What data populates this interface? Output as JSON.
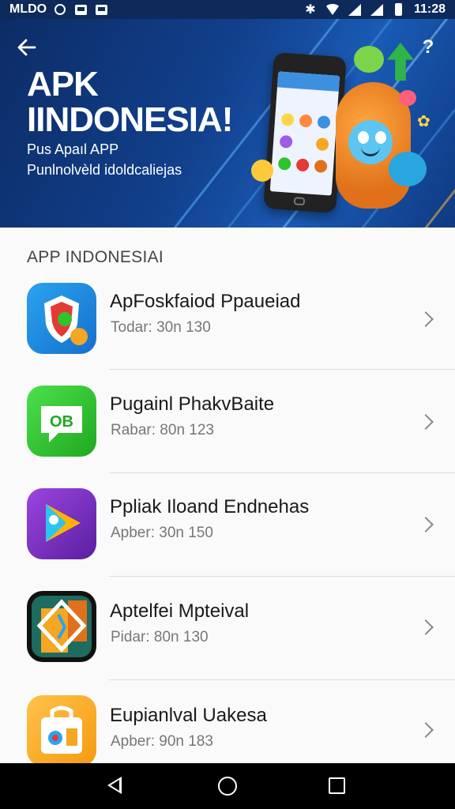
{
  "status_bar": {
    "carrier": "MLDO",
    "time": "11:28",
    "icons": [
      "sync-icon",
      "gallery-icon",
      "image-icon",
      "bluetooth-icon",
      "wifi-icon",
      "signal-icon",
      "signal-icon",
      "battery-icon"
    ]
  },
  "banner": {
    "title_line1": "APK",
    "title_line2": "IINDONESIA!",
    "subtitle_line1": "Pus Apaıl APP",
    "subtitle_line2": "Punlnolvèld idoldcaliejas",
    "back_icon": "arrow-left-icon",
    "help_icon": "question-icon",
    "colors": {
      "bg_start": "#0c2c66",
      "bg_end": "#1a5bb5",
      "accent": "#ff9f2e"
    }
  },
  "section": {
    "title": "APP INDONESIAI"
  },
  "apps": [
    {
      "name": "ApFoskfaiod Ppaueiad",
      "meta": "Todar: 30n 130",
      "icon": "shield-app-icon",
      "icon_bg": "#1c8fe3"
    },
    {
      "name": "Pugainl PhakvBaite",
      "meta": "Rabar: 80n 123",
      "icon": "chat-app-icon",
      "icon_bg": "#2ec42e"
    },
    {
      "name": "Ppliak Iloand Endnehas",
      "meta": "Apber: 30n 150",
      "icon": "play-app-icon",
      "icon_bg": "#7a2ec2"
    },
    {
      "name": "Aptelfei Mpteival",
      "meta": "Pidar: 80n 130",
      "icon": "map-app-icon",
      "icon_bg": "#1e5f57"
    },
    {
      "name": "Eupianlval Uakesa",
      "meta": "Apber: 90n 183",
      "icon": "bag-app-icon",
      "icon_bg": "#f5a623"
    }
  ],
  "nav": {
    "back": "back-icon",
    "home": "home-icon",
    "recents": "recents-icon"
  }
}
